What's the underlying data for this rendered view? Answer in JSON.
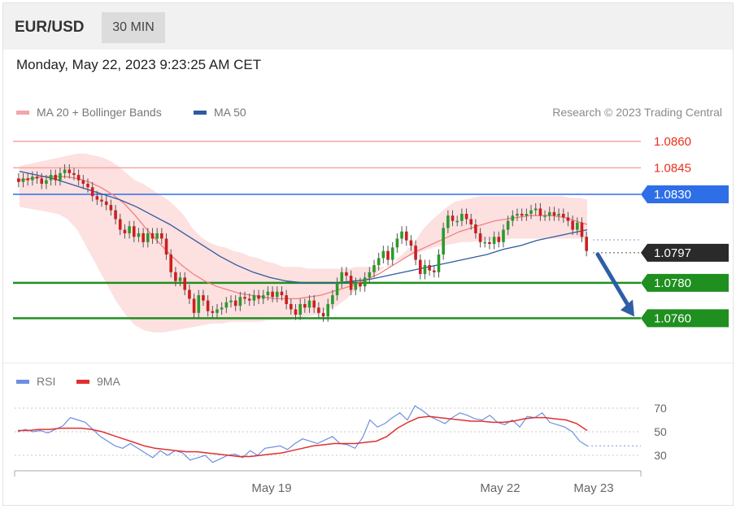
{
  "header": {
    "symbol": "EUR/USD",
    "timeframe": "30 MIN"
  },
  "datetime": "Monday, May 22, 2023 9:23:25 AM CET",
  "legend": {
    "ma20_label": "MA 20 + Bollinger Bands",
    "ma50_label": "MA 50",
    "credit": "Research © 2023 Trading Central",
    "rsi_label": "RSI",
    "rsi_ma_label": "9MA"
  },
  "colors": {
    "ma20": "#f08080",
    "ma50": "#2f5b9e",
    "bollinger_fill": "#fde0e0",
    "resistance": "#f4a6a6",
    "pivot_blue": "#2e6fe8",
    "support_green": "#1f8f1f",
    "current_price": "#2a2a2a",
    "arrow": "#2e5fa6",
    "candle": "#2b9a2b",
    "candle_bear": "#cc1f1f",
    "rsi": "#6e8fe0",
    "rsi_ma": "#e03030"
  },
  "chart_data": [
    {
      "type": "candlestick",
      "ylim": [
        1.0745,
        1.087
      ],
      "x_ticks": [
        "May 19",
        "May 22",
        "May 23"
      ],
      "levels": [
        {
          "value": 1.086,
          "label": "1.0860",
          "role": "resistance"
        },
        {
          "value": 1.0845,
          "label": "1.0845",
          "role": "resistance"
        },
        {
          "value": 1.083,
          "label": "1.0830",
          "role": "pivot"
        },
        {
          "value": 1.0797,
          "label": "1.0797",
          "role": "current price"
        },
        {
          "value": 1.078,
          "label": "1.0780",
          "role": "support"
        },
        {
          "value": 1.076,
          "label": "1.0760",
          "role": "support"
        }
      ],
      "close": [
        1.0837,
        1.0839,
        1.0838,
        1.084,
        1.0839,
        1.0836,
        1.0838,
        1.0841,
        1.0838,
        1.0842,
        1.0844,
        1.0842,
        1.0841,
        1.0838,
        1.0836,
        1.0834,
        1.0829,
        1.0827,
        1.0826,
        1.0824,
        1.0821,
        1.0816,
        1.081,
        1.0808,
        1.0812,
        1.0806,
        1.0808,
        1.0803,
        1.0808,
        1.0805,
        1.0808,
        1.0805,
        1.0796,
        1.0786,
        1.0781,
        1.0783,
        1.0776,
        1.0771,
        1.0763,
        1.0773,
        1.077,
        1.0764,
        1.0763,
        1.0765,
        1.0766,
        1.0769,
        1.077,
        1.0767,
        1.0772,
        1.0771,
        1.077,
        1.0773,
        1.0771,
        1.0773,
        1.0775,
        1.0772,
        1.0775,
        1.0773,
        1.0768,
        1.0765,
        1.0762,
        1.0768,
        1.0766,
        1.077,
        1.0766,
        1.0763,
        1.0761,
        1.0768,
        1.0773,
        1.078,
        1.0786,
        1.0784,
        1.0776,
        1.078,
        1.0778,
        1.0783,
        1.0786,
        1.079,
        1.0794,
        1.0798,
        1.0793,
        1.08,
        1.0805,
        1.0809,
        1.0804,
        1.0801,
        1.0793,
        1.0785,
        1.079,
        1.0787,
        1.0786,
        1.0796,
        1.0811,
        1.0818,
        1.0815,
        1.0815,
        1.0819,
        1.0816,
        1.0813,
        1.0808,
        1.0803,
        1.0803,
        1.0802,
        1.0806,
        1.0803,
        1.081,
        1.0815,
        1.0818,
        1.0819,
        1.0818,
        1.0819,
        1.0821,
        1.0822,
        1.0818,
        1.0818,
        1.082,
        1.0818,
        1.0819,
        1.0817,
        1.0815,
        1.081,
        1.0814,
        1.0806,
        1.0798
      ],
      "bollinger_upper": [
        1.0846,
        1.0847,
        1.0848,
        1.0849,
        1.085,
        1.0851,
        1.0852,
        1.0853,
        1.0853,
        1.0852,
        1.0851,
        1.0849,
        1.0846,
        1.0842,
        1.0838,
        1.0836,
        1.0833,
        1.083,
        1.0827,
        1.0823,
        1.0818,
        1.0811,
        1.0806,
        1.0803,
        1.0801,
        1.08,
        1.0798,
        1.0797,
        1.0795,
        1.0794,
        1.0792,
        1.0791,
        1.0789,
        1.0789,
        1.0789,
        1.0788,
        1.0788,
        1.0788,
        1.0788,
        1.0788,
        1.0788,
        1.0789,
        1.0789,
        1.0789,
        1.0789,
        1.0789,
        1.0794,
        1.0798,
        1.0803,
        1.081,
        1.0815,
        1.0819,
        1.0823,
        1.0826,
        1.0827,
        1.0828,
        1.0829,
        1.0829,
        1.0829,
        1.0829,
        1.0829,
        1.0829,
        1.0829,
        1.0829,
        1.0829,
        1.0829,
        1.0829,
        1.0828,
        1.0828,
        1.0827
      ],
      "bollinger_lower": [
        1.0823,
        1.0822,
        1.0821,
        1.082,
        1.0819,
        1.0816,
        1.081,
        1.08,
        1.079,
        1.078,
        1.077,
        1.0762,
        1.0756,
        1.0753,
        1.0752,
        1.0752,
        1.0753,
        1.0754,
        1.0755,
        1.0756,
        1.0757,
        1.0757,
        1.0758,
        1.0758,
        1.0758,
        1.0758,
        1.0759,
        1.0759,
        1.0759,
        1.076,
        1.0761,
        1.0762,
        1.0765,
        1.0767,
        1.0771,
        1.0776,
        1.078,
        1.0785,
        1.0789,
        1.0792,
        1.0794,
        1.0796,
        1.0798,
        1.08,
        1.0801,
        1.0802,
        1.0803,
        1.0803,
        1.0804,
        1.0804,
        1.0804,
        1.0805,
        1.0805,
        1.0805,
        1.0805,
        1.0805,
        1.0805,
        1.0805,
        1.0805,
        1.0805
      ],
      "ma20": [
        1.0838,
        1.0839,
        1.084,
        1.084,
        1.084,
        1.0839,
        1.0837,
        1.0834,
        1.083,
        1.0825,
        1.0818,
        1.081,
        1.0803,
        1.0796,
        1.079,
        1.0785,
        1.0781,
        1.0778,
        1.0776,
        1.0774,
        1.0773,
        1.0772,
        1.0771,
        1.0771,
        1.0771,
        1.0772,
        1.0773,
        1.0775,
        1.0777,
        1.0779,
        1.0782,
        1.0785,
        1.0789,
        1.0793,
        1.0797,
        1.08,
        1.0803,
        1.0806,
        1.0809,
        1.0811,
        1.0813,
        1.0815,
        1.0816,
        1.0817,
        1.0818,
        1.0818,
        1.0818,
        1.0817,
        1.0815,
        1.0813
      ],
      "ma50": [
        1.0843,
        1.0841,
        1.0839,
        1.0836,
        1.0833,
        1.083,
        1.0827,
        1.0823,
        1.0818,
        1.0813,
        1.0807,
        1.0801,
        1.0795,
        1.079,
        1.0786,
        1.0783,
        1.0781,
        1.078,
        1.078,
        1.078,
        1.0781,
        1.0782,
        1.0784,
        1.0786,
        1.0788,
        1.079,
        1.0792,
        1.0794,
        1.0796,
        1.0799,
        1.0801,
        1.0804,
        1.0806,
        1.0808,
        1.081
      ],
      "projection": {
        "from": 1.0797,
        "to": 1.076
      }
    },
    {
      "type": "line",
      "ylim": [
        23,
        77
      ],
      "y_ticks": [
        "70",
        "50",
        "30"
      ],
      "series": [
        {
          "name": "RSI",
          "values": [
            50,
            52,
            50,
            51,
            49,
            52,
            55,
            62,
            60,
            58,
            52,
            46,
            42,
            38,
            36,
            40,
            36,
            32,
            28,
            34,
            30,
            34,
            32,
            26,
            28,
            30,
            24,
            27,
            30,
            31,
            28,
            34,
            30,
            36,
            37,
            38,
            35,
            40,
            44,
            42,
            40,
            43,
            46,
            40,
            39,
            36,
            45,
            60,
            54,
            57,
            62,
            66,
            60,
            72,
            68,
            63,
            60,
            57,
            62,
            66,
            64,
            61,
            60,
            64,
            58,
            56,
            60,
            54,
            63,
            62,
            66,
            58,
            56,
            54,
            50,
            42,
            38
          ]
        },
        {
          "name": "9MA",
          "values": [
            51,
            51,
            52,
            52,
            53,
            53,
            53,
            52,
            50,
            47,
            44,
            41,
            38,
            36,
            35,
            34,
            33,
            33,
            32,
            31,
            30,
            29,
            29,
            30,
            31,
            32,
            34,
            36,
            38,
            39,
            40,
            40,
            40,
            41,
            42,
            46,
            53,
            58,
            62,
            63,
            62,
            61,
            60,
            59,
            59,
            58,
            58,
            59,
            61,
            62,
            62,
            61,
            60,
            57,
            51
          ]
        }
      ]
    }
  ]
}
